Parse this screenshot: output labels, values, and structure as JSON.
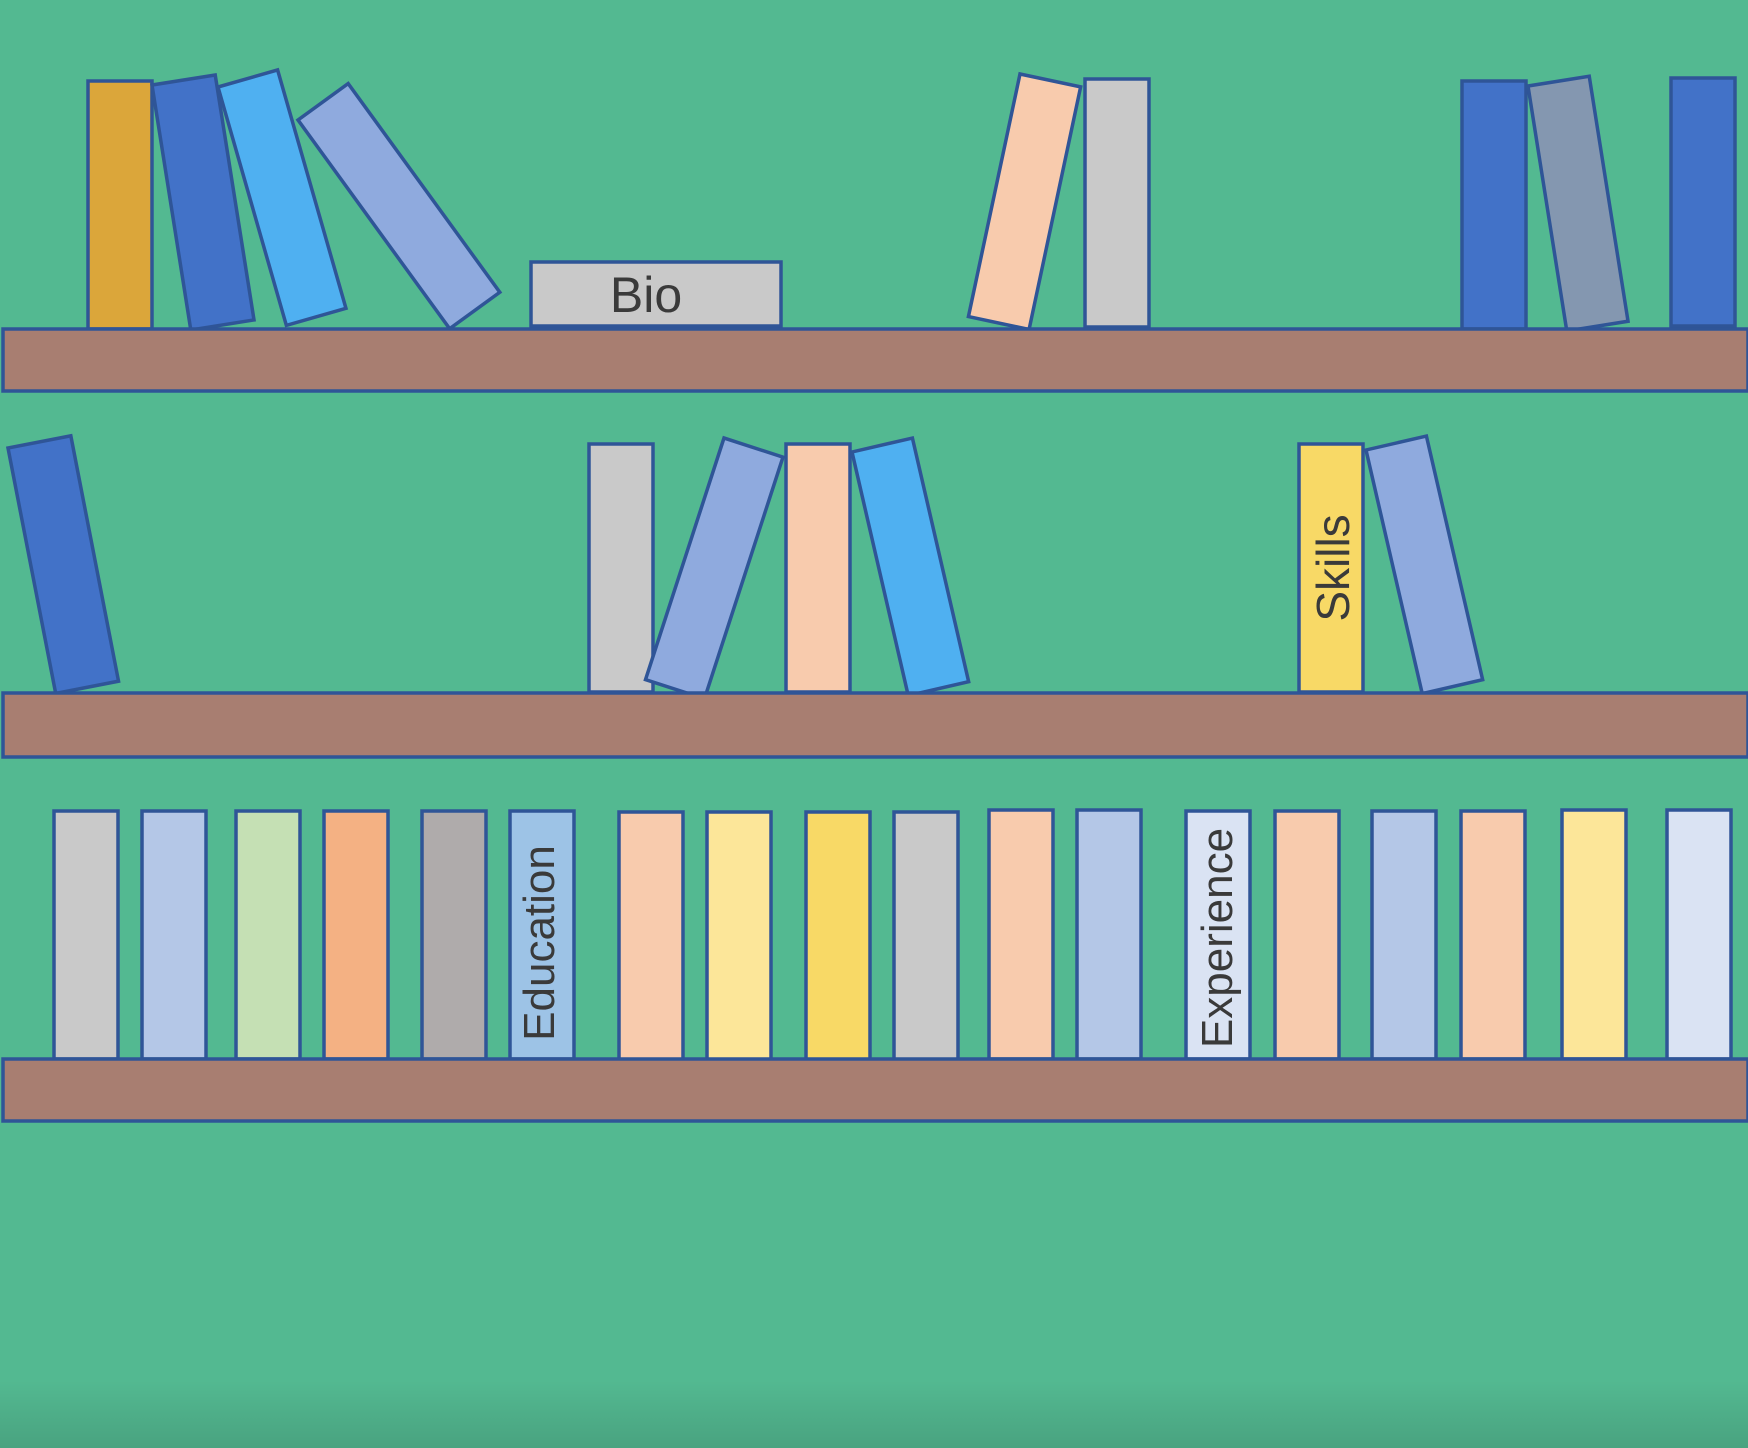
{
  "colors": {
    "background": "#53b991",
    "shelf": "#a87e71",
    "outline": "#2f5597",
    "text": "#3a3a3a"
  },
  "labels": {
    "bio": "Bio",
    "skills": "Skills",
    "education": "Education",
    "experience": "Experience"
  },
  "book_colors": {
    "shelf1": [
      "#dba63a",
      "#4272c8",
      "#4fb0f1",
      "#8faade",
      "#f8cbad",
      "#c9c9c9",
      "#4272c8",
      "#8497b0",
      "#4272c8"
    ],
    "bio_book": "#c9c9c9",
    "shelf2": [
      "#4272c8",
      "#c9c9c9",
      "#8faade",
      "#f8cbad",
      "#4fb0f1",
      "#f8d966",
      "#8faade"
    ],
    "shelf3": [
      "#c9c9c9",
      "#b4c7e7",
      "#c5e0b4",
      "#f4b183",
      "#afabab",
      "#9dc3e6",
      "#f8cbad",
      "#fce699",
      "#f8d966",
      "#c9c9c9",
      "#f8cbad",
      "#b4c7e7",
      "#dae3f3",
      "#f8cbad",
      "#b4c7e7",
      "#f8cbad",
      "#fce699",
      "#dae3f3"
    ]
  }
}
